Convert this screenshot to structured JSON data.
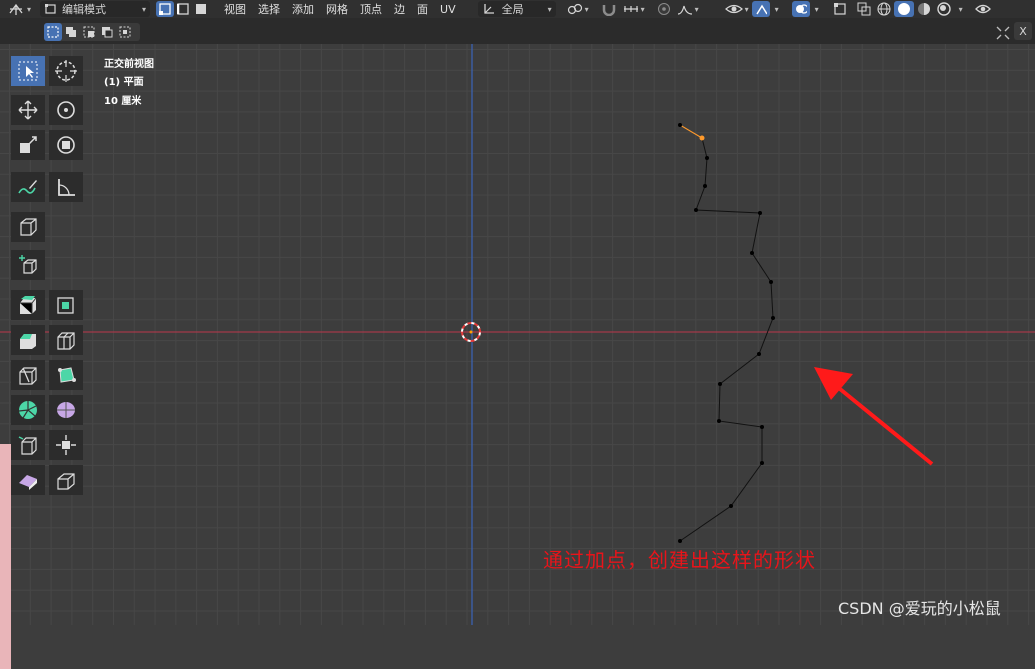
{
  "header": {
    "mode_dropdown": "编辑模式",
    "menus": [
      "视图",
      "选择",
      "添加",
      "网格",
      "顶点",
      "边",
      "面",
      "UV"
    ],
    "transform_orientation": "全局"
  },
  "viewport": {
    "view_name": "正交前视图",
    "object_name": "(1) 平面",
    "scale_label": "10 厘米"
  },
  "annotation": {
    "text": "通过加点，创建出这样的形状",
    "color": "#e8141a"
  },
  "watermark": "CSDN @爱玩的小松鼠",
  "colors": {
    "x_axis": "#a3394a",
    "z_axis": "#3b62b0",
    "active_tool": "#4772b3",
    "selected_vertex": "#ff9a2b"
  },
  "tools": [
    "select-box-icon",
    "cursor-icon",
    "move-icon",
    "rotate-icon",
    "scale-icon",
    "transform-icon",
    "annotate-icon",
    "measure-icon",
    "add-cube-icon",
    "add-primitive-icon",
    "extrude-icon",
    "inset-icon",
    "bevel-icon",
    "loop-cut-icon",
    "knife-icon",
    "poly-build-icon",
    "spin-icon",
    "smooth-icon",
    "edge-slide-icon",
    "shrink-fatten-icon",
    "shear-icon",
    "rip-icon"
  ]
}
